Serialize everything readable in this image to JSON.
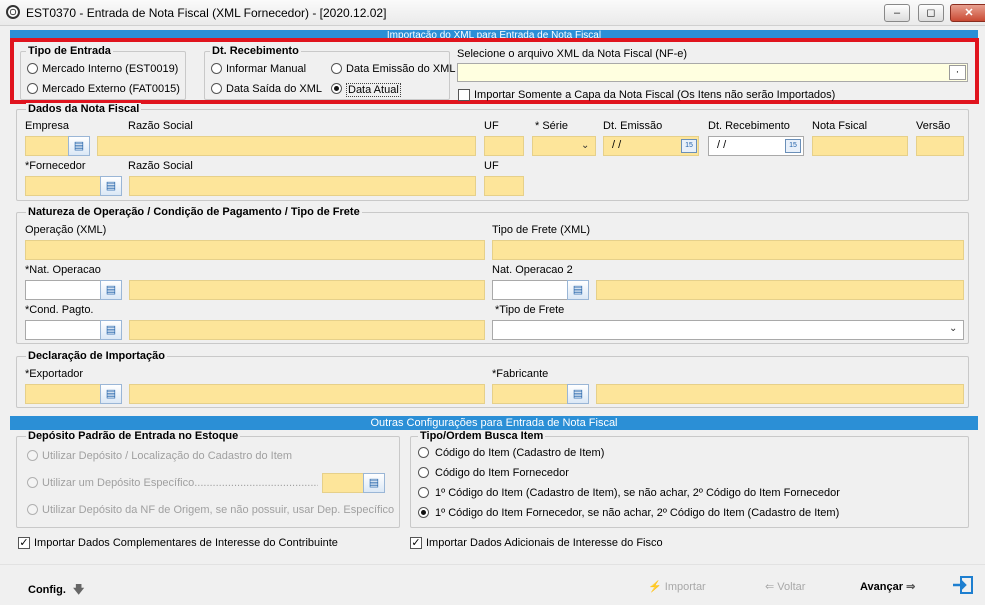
{
  "window": {
    "title": "EST0370 - Entrada de Nota Fiscal (XML Fornecedor) - [2020.12.02]",
    "minimize": "–",
    "restore": "◻",
    "close": "✕"
  },
  "header_strip": "Importação do XML para Entrada de Nota Fiscal",
  "tipo_entrada": {
    "title": "Tipo de Entrada",
    "options": [
      "Mercado Interno (EST0019)",
      "Mercado Externo (FAT0015)"
    ]
  },
  "dt_recebimento": {
    "title": "Dt. Recebimento",
    "options": [
      "Informar Manual",
      "Data Emissão do XML",
      "Data Saída do XML",
      "Data Atual"
    ],
    "selected": "Data Atual"
  },
  "xml_file": {
    "label": "Selecione o arquivo XML da Nota Fiscal (NF-e)",
    "browse": "·",
    "capa_only": "Importar Somente a Capa da Nota Fiscal (Os Itens não serão Importados)"
  },
  "dados_nf": {
    "title": "Dados da Nota Fiscal",
    "labels": {
      "empresa": "Empresa",
      "razao1": "Razão Social",
      "uf1": "UF",
      "serie": "* Série",
      "dt_emissao": "Dt. Emissão",
      "dt_recebimento": "Dt. Recebimento",
      "nota_fiscal": "Nota Fsical",
      "versao": "Versão",
      "fornecedor": "*Fornecedor",
      "razao2": "Razão Social",
      "uf2": "UF"
    },
    "dt_emissao_value": "/ /",
    "dt_recebimento_value": "/ /"
  },
  "natureza": {
    "title": "Natureza de Operação / Condição de Pagamento / Tipo de Frete",
    "operacao_xml": "Operação (XML)",
    "tipo_frete_xml": "Tipo de Frete (XML)",
    "nat_operacao": "*Nat. Operacao",
    "nat_operacao2": "Nat. Operacao 2",
    "cond_pagto": "*Cond. Pagto.",
    "tipo_frete": "*Tipo de Frete"
  },
  "importacao": {
    "title": "Declaração de Importação",
    "exportador": "*Exportador",
    "fabricante": "*Fabricante"
  },
  "outras_strip": "Outras Configurações para Entrada de Nota Fiscal",
  "deposito": {
    "title": "Depósito Padrão de Entrada no Estoque",
    "options": [
      "Utilizar Depósito / Localização do Cadastro do Item",
      "Utilizar um Depósito Específico...........................................",
      "Utilizar Depósito da NF de Origem, se não possuir, usar Dep. Específico"
    ]
  },
  "busca_item": {
    "title": "Tipo/Ordem Busca Item",
    "options": [
      "Código do Item (Cadastro de Item)",
      "Código do Item Fornecedor",
      "1º Código do Item (Cadastro de Item), se não achar, 2º Código do Item Fornecedor",
      "1º Código do Item Fornecedor, se não achar, 2º Código do Item (Cadastro de Item)"
    ],
    "selected_index": 3
  },
  "checks": {
    "complementares": "Importar Dados Complementares de Interesse do Contribuinte",
    "fisco": "Importar Dados Adicionais de Interesse do Fisco"
  },
  "footer": {
    "config": "Config.",
    "importar": "Importar",
    "voltar": "Voltar",
    "avancar": "Avançar"
  },
  "colors": {
    "field_yellow": "#fde59a",
    "strip_blue": "#2b8fd6",
    "highlight_red": "#e0141e"
  }
}
